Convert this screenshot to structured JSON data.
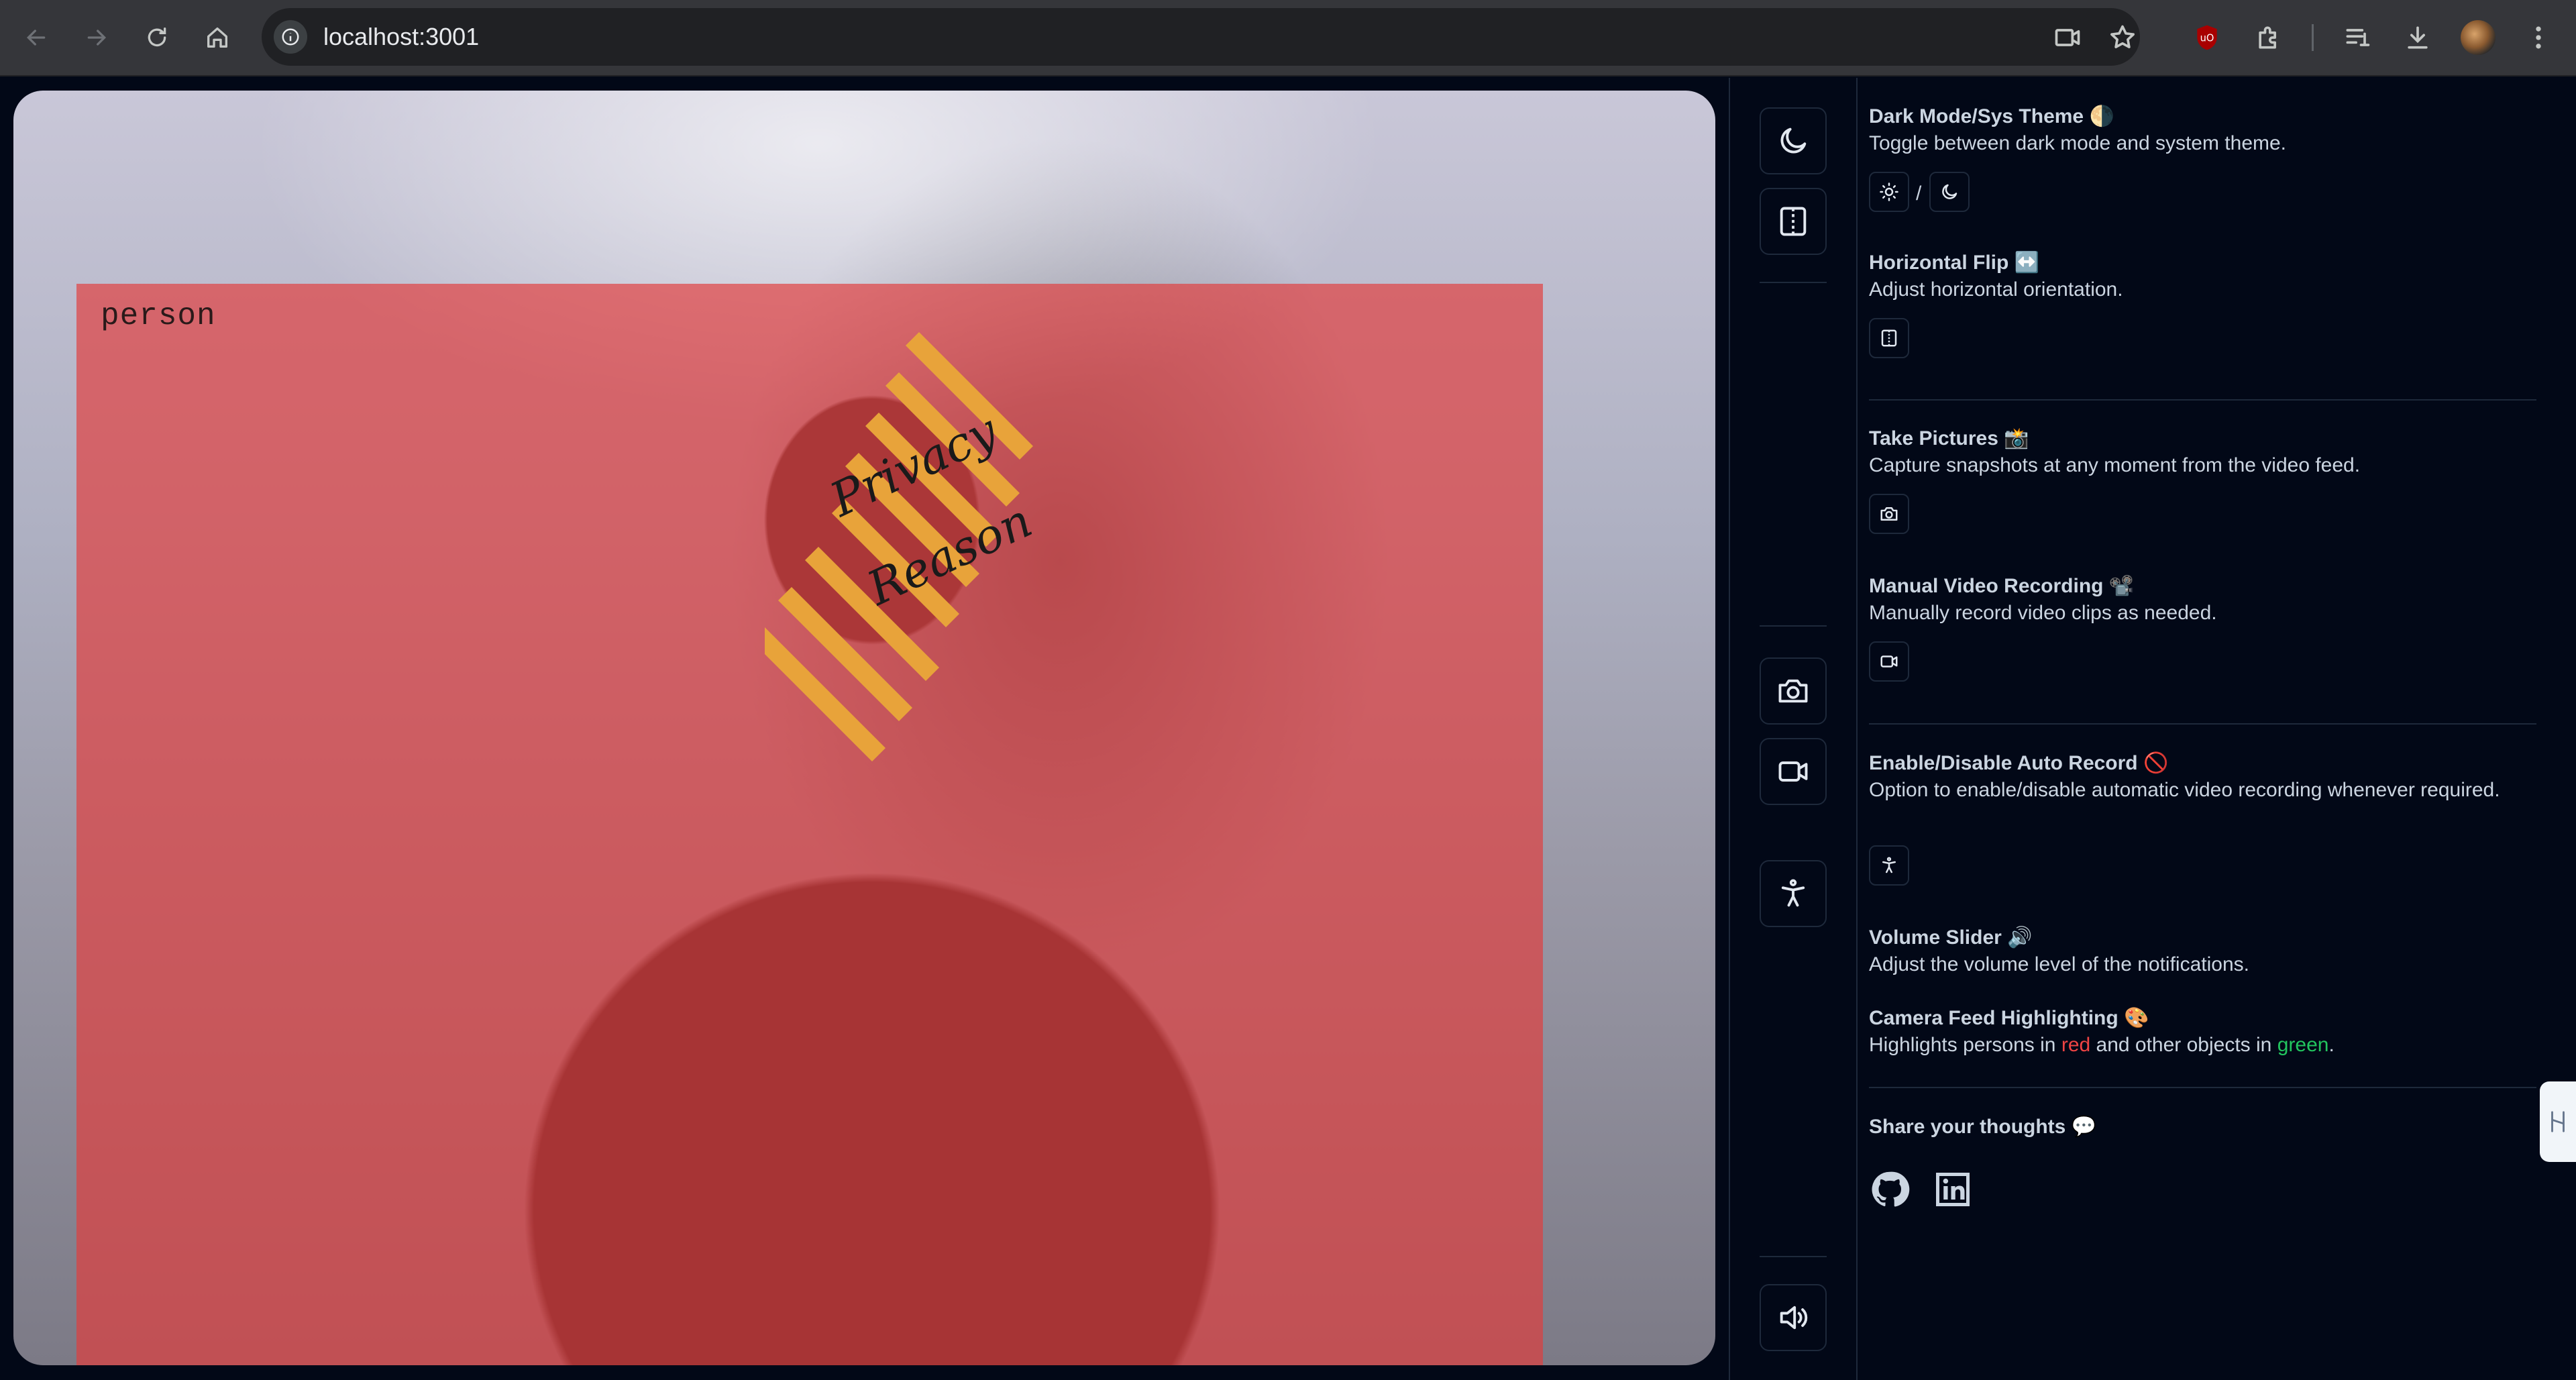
{
  "browser": {
    "url": "localhost:3001"
  },
  "video": {
    "detection_label": "person",
    "mask_text_line1": "Privacy",
    "mask_text_line2": "Reason"
  },
  "panel": {
    "dark_mode": {
      "title": "Dark Mode/Sys Theme 🌗",
      "desc": "Toggle between dark mode and system theme.",
      "separator": "/"
    },
    "flip": {
      "title": "Horizontal Flip ↔️",
      "desc": "Adjust horizontal orientation."
    },
    "pictures": {
      "title": "Take Pictures 📸",
      "desc": "Capture snapshots at any moment from the video feed."
    },
    "recording": {
      "title": "Manual Video Recording 📽️",
      "desc": "Manually record video clips as needed."
    },
    "auto_record": {
      "title": "Enable/Disable Auto Record 🚫",
      "desc": "Option to enable/disable automatic video recording whenever required."
    },
    "volume": {
      "title": "Volume Slider 🔊",
      "desc": "Adjust the volume level of the notifications."
    },
    "highlight": {
      "title": "Camera Feed Highlighting 🎨",
      "desc_prefix": "Highlights persons in ",
      "desc_red": "red",
      "desc_mid": " and other objects in ",
      "desc_green": "green",
      "desc_suffix": "."
    },
    "share": {
      "title": "Share your thoughts 💬"
    }
  },
  "colors": {
    "background": "#020817",
    "person_highlight": "#e13c3c",
    "privacy_mask": "#e8a33a",
    "highlight_red": "#ef4444",
    "highlight_green": "#22c55e"
  },
  "icons": [
    "back-icon",
    "forward-icon",
    "reload-icon",
    "home-icon",
    "site-info-icon",
    "camera-icon",
    "star-icon",
    "ublock-icon",
    "extensions-icon",
    "reading-list-icon",
    "download-icon",
    "menu-icon",
    "moon-icon",
    "flip-icon",
    "video-icon",
    "accessibility-icon",
    "volume-icon",
    "sun-icon",
    "github-icon",
    "linkedin-icon"
  ]
}
